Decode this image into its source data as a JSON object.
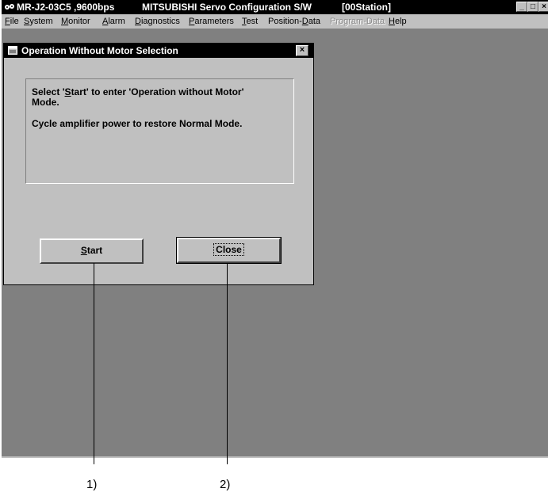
{
  "window": {
    "title_parts": [
      "MR-J2-03C5 ,9600bps",
      "MITSUBISHI Servo Configuration S/W",
      "[00Station]"
    ],
    "controls": [
      "_",
      "□",
      "×"
    ],
    "colors": {
      "titlebar": "#000000",
      "face": "#c0c0c0",
      "workspace": "#808080"
    }
  },
  "menu": [
    {
      "pre": "",
      "key": "F",
      "post": "ile",
      "enabled": true
    },
    {
      "pre": "",
      "key": "S",
      "post": "ystem",
      "enabled": true
    },
    {
      "pre": "",
      "key": "M",
      "post": "onitor",
      "enabled": true
    },
    {
      "pre": "",
      "key": "A",
      "post": "larm",
      "enabled": true
    },
    {
      "pre": "",
      "key": "D",
      "post": "iagnostics",
      "enabled": true
    },
    {
      "pre": "",
      "key": "P",
      "post": "arameters",
      "enabled": true
    },
    {
      "pre": "",
      "key": "T",
      "post": "est",
      "enabled": true
    },
    {
      "pre": "Position-",
      "key": "D",
      "post": "ata",
      "enabled": true
    },
    {
      "pre": "Program-Data",
      "key": "",
      "post": "",
      "enabled": false
    },
    {
      "pre": "",
      "key": "H",
      "post": "elp",
      "enabled": true
    }
  ],
  "dialog": {
    "title": "Operation Without Motor Selection",
    "close_glyph": "×",
    "message": {
      "line1_pre": "Select '",
      "line1_key": "S",
      "line1_post": "tart' to enter 'Operation without Motor'",
      "line2": "Mode.",
      "line3": "Cycle amplifier power to restore Normal Mode."
    },
    "start_button": {
      "key": "S",
      "rest": "tart"
    },
    "close_button": {
      "label": "Close"
    }
  },
  "callouts": {
    "label1": "1)",
    "label2": "2)"
  }
}
